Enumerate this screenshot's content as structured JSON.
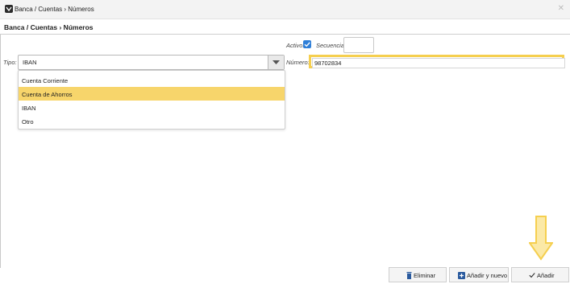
{
  "window": {
    "title": "Banca / Cuentas › Números",
    "close_glyph": "✕"
  },
  "header": {
    "title": "Banca / Cuentas › Números"
  },
  "form": {
    "activo_label": "Activo:",
    "activo_checked": true,
    "secuencia_label": "Secuencia:",
    "secuencia_value": "",
    "tipo_label": "Tipo:",
    "tipo_value": "IBAN",
    "numero_label": "Número:",
    "numero_value": "98702834"
  },
  "dropdown": {
    "options": [
      {
        "label": "Cuenta Corriente",
        "highlighted": false
      },
      {
        "label": "Cuenta de Ahorros",
        "highlighted": true
      },
      {
        "label": "IBAN",
        "highlighted": false
      },
      {
        "label": "Otro",
        "highlighted": false
      }
    ]
  },
  "footer": {
    "delete_label": "Eliminar",
    "add_new_label": "Añadir y nuevo",
    "add_label": "Añadir"
  },
  "colors": {
    "highlight": "#f7d56b",
    "annotation": "#f5cf4f",
    "checkbox": "#2f7fd8"
  },
  "icons": {
    "app": "app-logo-icon",
    "close": "close-icon",
    "dropdown_arrow": "chevron-down-icon",
    "checkbox": "checkmark-icon",
    "delete": "trash-icon",
    "add_new": "plus-square-icon",
    "add": "check-icon",
    "annotation": "arrow-down-icon"
  }
}
